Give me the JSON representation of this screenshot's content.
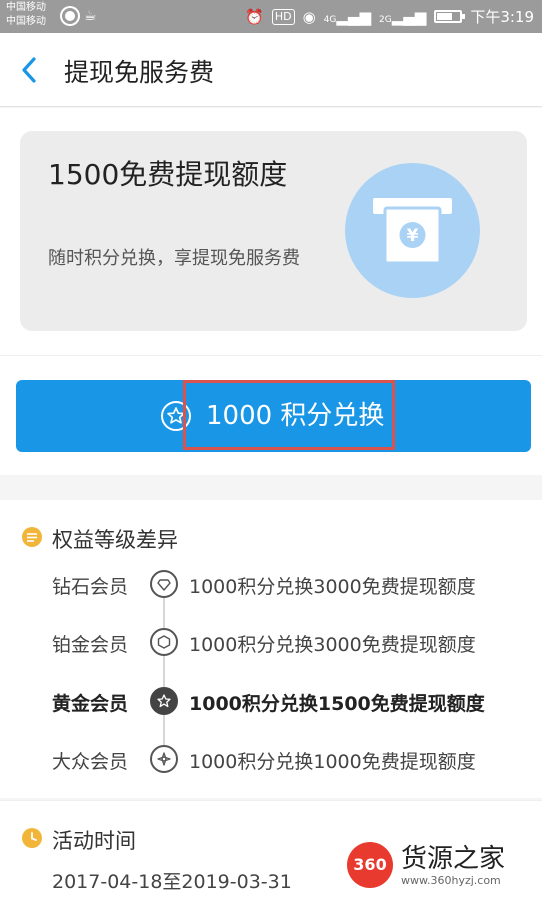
{
  "status_bar": {
    "carrier_1": "中国移动",
    "carrier_2": "中国移动",
    "hd_badge": "HD",
    "signal_1": "4G",
    "signal_2": "2G",
    "time": "下午3:19",
    "icons": [
      "navigation-icon",
      "app-icon",
      "alarm-icon",
      "eye-icon",
      "signal-icon",
      "battery-icon"
    ]
  },
  "header": {
    "title": "提现免服务费",
    "back_icon": "chevron-left-icon"
  },
  "hero": {
    "title": "1500免费提现额度",
    "subtitle": "随时积分兑换，享提现免服务费",
    "icon": "atm-yuan-icon"
  },
  "exchange_button": {
    "label": "1000 积分兑换",
    "icon": "star-badge-icon"
  },
  "benefits": {
    "title": "权益等级差异",
    "rows": [
      {
        "tier": "钻石会员",
        "desc": "1000积分兑换3000免费提现额度",
        "icon": "diamond-icon",
        "active": false
      },
      {
        "tier": "铂金会员",
        "desc": "1000积分兑换3000免费提现额度",
        "icon": "hexagon-icon",
        "active": false
      },
      {
        "tier": "黄金会员",
        "desc": "1000积分兑换1500免费提现额度",
        "icon": "star-icon",
        "active": true
      },
      {
        "tier": "大众会员",
        "desc": "1000积分兑换1000免费提现额度",
        "icon": "compass-icon",
        "active": false
      }
    ]
  },
  "activity": {
    "title": "活动时间",
    "date_range": "2017-04-18至2019-03-31"
  },
  "watermark": {
    "badge": "360",
    "text": "货源之家",
    "url": "www.360hyzj.com"
  },
  "colors": {
    "primary": "#1a96e6",
    "hero_circle": "#a9d2f5",
    "section_icon": "#f1b53a",
    "highlight": "#d9534f"
  }
}
